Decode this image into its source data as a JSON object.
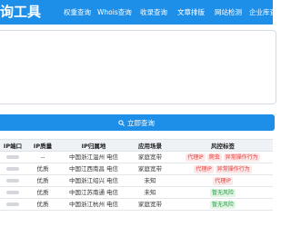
{
  "header": {
    "brand": "询工具",
    "nav": [
      "权重查询",
      "Whois查询",
      "收录查询",
      "文章排版",
      "网站检测",
      "企业库查询"
    ]
  },
  "input": {
    "value": "",
    "placeholder": ""
  },
  "query_button": {
    "label": "立即查询",
    "icon": "search-icon"
  },
  "table": {
    "headers": [
      "IP端口",
      "IP质量",
      "IP归属地",
      "应用场景",
      "风控标签"
    ],
    "rows": [
      {
        "quality": "--",
        "location": "中国浙江温州 电信",
        "scene": "家庭宽带",
        "tags": [
          {
            "text": "代理IP",
            "color": "red"
          },
          {
            "text": "爬虫",
            "color": "red"
          },
          {
            "text": "异常操作行为",
            "color": "red"
          }
        ]
      },
      {
        "quality": "优质",
        "location": "中国江西南昌 电信",
        "scene": "家庭宽带",
        "tags": [
          {
            "text": "代理IP",
            "color": "red"
          },
          {
            "text": "异常操作行为",
            "color": "red"
          }
        ]
      },
      {
        "quality": "优质",
        "location": "中国浙江绍兴 电信",
        "scene": "未知",
        "tags": [
          {
            "text": "代理IP",
            "color": "red"
          }
        ]
      },
      {
        "quality": "优质",
        "location": "中国江苏南通 电信",
        "scene": "未知",
        "tags": [
          {
            "text": "暂无风险",
            "color": "green"
          }
        ]
      },
      {
        "quality": "优质",
        "location": "中国浙江杭州 电信",
        "scene": "家庭宽带",
        "tags": [
          {
            "text": "暂无风险",
            "color": "green"
          }
        ]
      }
    ]
  },
  "colors": {
    "primary": "#1e8fe8",
    "risk": "#e53935",
    "safe": "#26a044"
  }
}
